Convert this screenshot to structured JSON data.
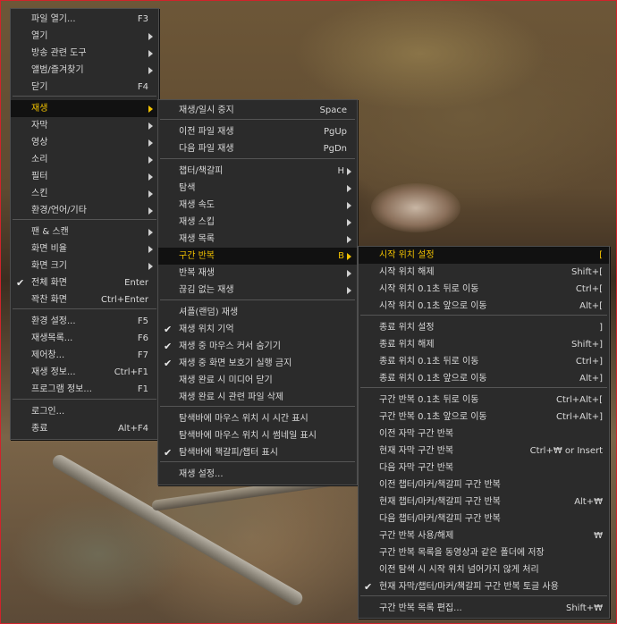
{
  "main_menu": {
    "items": [
      {
        "label": "파일 열기...",
        "shortcut": "F3"
      },
      {
        "label": "열기",
        "submenu": true
      },
      {
        "label": "방송 관련 도구",
        "submenu": true
      },
      {
        "label": "앨범/즐겨찾기",
        "submenu": true
      },
      {
        "label": "닫기",
        "shortcut": "F4"
      },
      {
        "label": "재생",
        "submenu": true,
        "highlighted": true
      },
      {
        "label": "자막",
        "submenu": true
      },
      {
        "label": "영상",
        "submenu": true
      },
      {
        "label": "소리",
        "submenu": true
      },
      {
        "label": "필터",
        "submenu": true
      },
      {
        "label": "스킨",
        "submenu": true
      },
      {
        "label": "환경/언어/기타",
        "submenu": true
      },
      {
        "label": "팬 & 스캔",
        "submenu": true
      },
      {
        "label": "화면 비율",
        "submenu": true
      },
      {
        "label": "화면 크기",
        "submenu": true
      },
      {
        "label": "전체 화면",
        "shortcut": "Enter",
        "checked": true
      },
      {
        "label": "꽉찬 화면",
        "shortcut": "Ctrl+Enter"
      },
      {
        "label": "환경 설정...",
        "shortcut": "F5"
      },
      {
        "label": "재생목록...",
        "shortcut": "F6"
      },
      {
        "label": "제어창...",
        "shortcut": "F7"
      },
      {
        "label": "재생 정보...",
        "shortcut": "Ctrl+F1"
      },
      {
        "label": "프로그램 정보...",
        "shortcut": "F1"
      },
      {
        "label": "로그인..."
      },
      {
        "label": "종료",
        "shortcut": "Alt+F4"
      }
    ]
  },
  "play_menu": {
    "items": [
      {
        "label": "재생/일시 중지",
        "shortcut": "Space"
      },
      {
        "label": "이전 파일 재생",
        "shortcut": "PgUp"
      },
      {
        "label": "다음 파일 재생",
        "shortcut": "PgDn"
      },
      {
        "label": "챕터/책갈피",
        "shortcut": "H",
        "submenu": true
      },
      {
        "label": "탐색",
        "submenu": true
      },
      {
        "label": "재생 속도",
        "submenu": true
      },
      {
        "label": "재생 스킵",
        "submenu": true
      },
      {
        "label": "재생 목록",
        "submenu": true
      },
      {
        "label": "구간 반복",
        "shortcut": "B",
        "submenu": true,
        "highlighted": true
      },
      {
        "label": "반복 재생",
        "submenu": true
      },
      {
        "label": "끊김 없는 재생",
        "submenu": true
      },
      {
        "label": "셔플(랜덤) 재생"
      },
      {
        "label": "재생 위치 기억",
        "checked": true
      },
      {
        "label": "재생 중 마우스 커서 숨기기",
        "checked": true
      },
      {
        "label": "재생 중 화면 보호기 실행 금지",
        "checked": true
      },
      {
        "label": "재생 완료 시 미디어 닫기"
      },
      {
        "label": "재생 완료 시 관련 파일 삭제"
      },
      {
        "label": "탐색바에 마우스 위치 시 시간 표시"
      },
      {
        "label": "탐색바에 마우스 위치 시 썸네일 표시"
      },
      {
        "label": "탐색바에 책갈피/챕터 표시",
        "checked": true
      },
      {
        "label": "재생 설정..."
      }
    ]
  },
  "repeat_menu": {
    "items": [
      {
        "label": "시작 위치 설정",
        "shortcut": "[",
        "highlighted": true
      },
      {
        "label": "시작 위치 해제",
        "shortcut": "Shift+["
      },
      {
        "label": "시작 위치 0.1초 뒤로 이동",
        "shortcut": "Ctrl+["
      },
      {
        "label": "시작 위치 0.1초 앞으로 이동",
        "shortcut": "Alt+["
      },
      {
        "label": "종료 위치 설정",
        "shortcut": "]"
      },
      {
        "label": "종료 위치 해제",
        "shortcut": "Shift+]"
      },
      {
        "label": "종료 위치 0.1초 뒤로 이동",
        "shortcut": "Ctrl+]"
      },
      {
        "label": "종료 위치 0.1초 앞으로 이동",
        "shortcut": "Alt+]"
      },
      {
        "label": "구간 반복 0.1초 뒤로 이동",
        "shortcut": "Ctrl+Alt+["
      },
      {
        "label": "구간 반복 0.1초 앞으로 이동",
        "shortcut": "Ctrl+Alt+]"
      },
      {
        "label": "이전 자막 구간 반복"
      },
      {
        "label": "현재 자막 구간 반복",
        "shortcut": "Ctrl+₩ or Insert"
      },
      {
        "label": "다음 자막 구간 반복"
      },
      {
        "label": "이전 챕터/마커/책갈피 구간 반복"
      },
      {
        "label": "현재 챕터/마커/책갈피 구간 반복",
        "shortcut": "Alt+₩"
      },
      {
        "label": "다음 챕터/마커/책갈피 구간 반복"
      },
      {
        "label": "구간 반복 사용/해제",
        "shortcut": "₩"
      },
      {
        "label": "구간 반복 목록을 동영상과 같은 폴더에 저장"
      },
      {
        "label": "이전 탐색 시 시작 위치 넘어가지 않게 처리"
      },
      {
        "label": "현재 자막/챕터/마커/책갈피 구간 반복 토글 사용",
        "checked": true
      },
      {
        "label": "구간 반복 목록 편집...",
        "shortcut": "Shift+₩"
      }
    ]
  },
  "colors": {
    "highlight_text": "#f2c200",
    "menu_bg": "#2b2b2b",
    "frame": "#d0232b"
  }
}
